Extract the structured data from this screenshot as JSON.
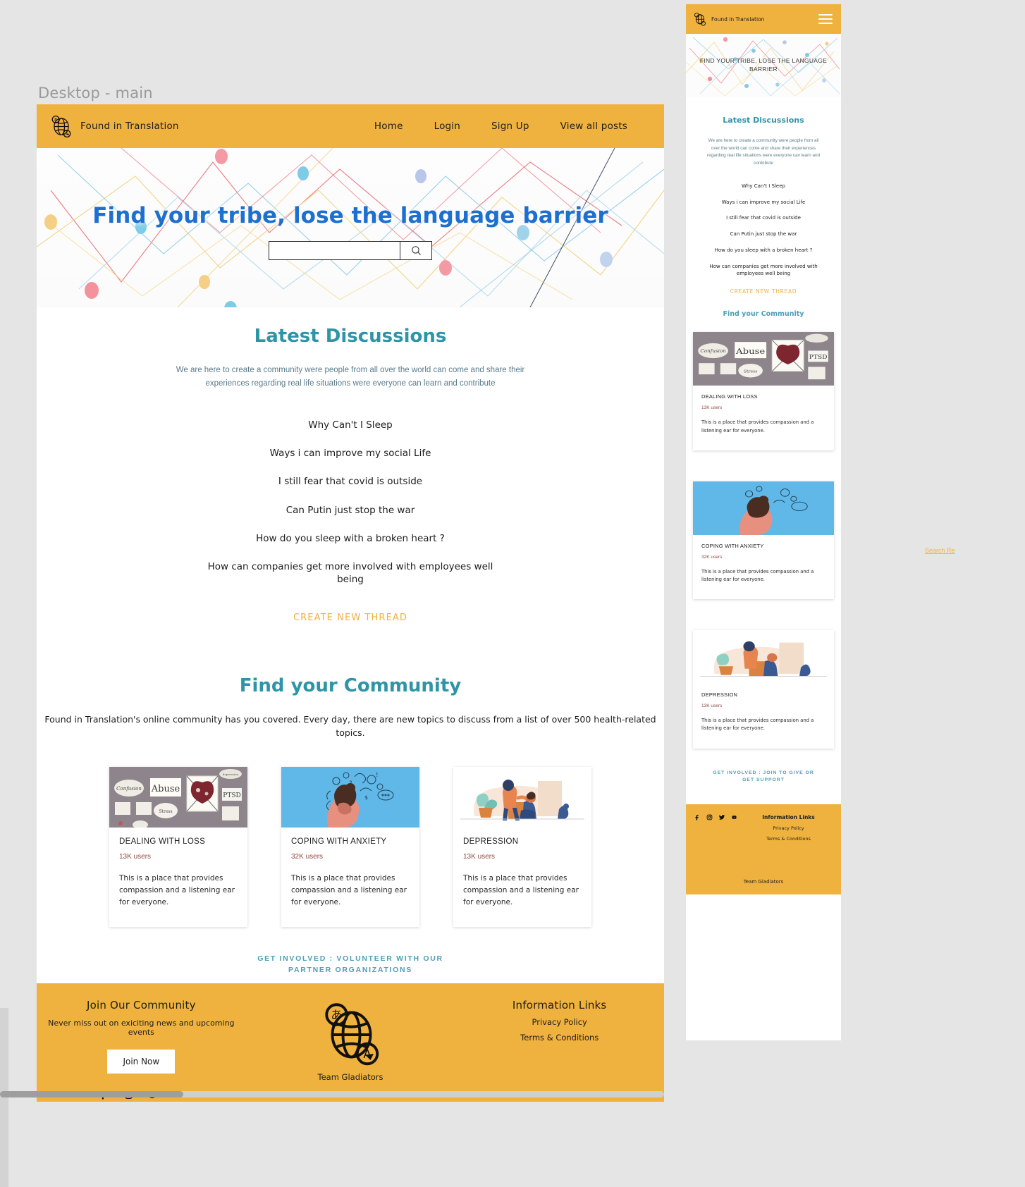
{
  "canvas": {
    "frame_label": "Desktop - main"
  },
  "brand": {
    "name": "Found in Translation",
    "logo_icon": "globe-translate-icon"
  },
  "desktop": {
    "nav": [
      {
        "label": "Home"
      },
      {
        "label": "Login"
      },
      {
        "label": "Sign Up"
      },
      {
        "label": "View all posts"
      }
    ],
    "hero": {
      "title": "Find your tribe, lose the language barrier",
      "search_value": "",
      "search_placeholder": "",
      "search_icon": "magnifier-icon"
    },
    "discussions": {
      "title": "Latest Discussions",
      "subtitle": "We are here to create a community were people from all over the world can come and share their experiences regarding  real life situations were everyone can learn and contribute",
      "threads": [
        "Why Can't I Sleep",
        "Ways i can improve my social Life",
        "I still fear that covid is outside",
        "Can Putin just stop the war",
        "How do you sleep with a broken heart ?",
        "How can companies get more involved with employees well being"
      ],
      "cta": "CREATE  NEW THREAD"
    },
    "community": {
      "title": "Find your Community",
      "subtitle": "Found in Translation's online community has you covered. Every day, there are new topics to discuss from a list of over 500 health-related topics.",
      "cards": [
        {
          "title": "DEALING WITH LOSS",
          "users": "13K users",
          "desc": "This is a place that provides compassion and a listening ear for everyone.",
          "image": "grief-board-photo"
        },
        {
          "title": "COPING WITH  ANXIETY",
          "users": "32K users",
          "desc": "This is a place that provides compassion and a listening ear for everyone.",
          "image": "anxiety-illustration"
        },
        {
          "title": "DEPRESSION",
          "users": "13K users",
          "desc": "This is a place that provides compassion and a listening ear for everyone.",
          "image": "depression-support-illustration"
        }
      ],
      "cta": "GET INVOLVED :  VOLUNTEER WITH OUR PARTNER ORGANIZATIONS"
    },
    "footer": {
      "join_heading": "Join Our Community",
      "join_text": "Never miss out on exiciting news and upcoming events",
      "join_button": "Join Now",
      "socials": [
        "facebook-icon",
        "instagram-icon",
        "twitter-icon",
        "youtube-icon"
      ],
      "team": "Team Gladiators",
      "info_heading": "Information Links",
      "info_links": [
        "Privacy Policy",
        "Terms & Conditions"
      ]
    }
  },
  "mobile": {
    "menu_icon": "hamburger-menu-icon",
    "hero_title": "FIND YOUR TRIBE, LOSE THE LANGUAGE BARRIER",
    "discussions": {
      "title": "Latest Discussions",
      "subtitle": "We are here to create a community were people from all over the world can come and share their experiences regarding  real life situations were everyone can learn and contribute",
      "threads": [
        "Why Can't I Sleep",
        "Ways i can improve my social Life",
        "I still fear that covid is outside",
        "Can Putin just stop the war",
        "How do you sleep with a broken heart ?",
        "How can companies get more involved with employees well being"
      ],
      "cta": "CREATE  NEW THREAD"
    },
    "community": {
      "title": "Find your Community",
      "cards": [
        {
          "title": "DEALING WITH LOSS",
          "users": "13K users",
          "desc": "This is a place that provides compassion and a listening ear for everyone.",
          "image": "grief-board-photo"
        },
        {
          "title": "COPING WITH  ANXIETY",
          "users": "32K users",
          "desc": "This is a place that provides compassion and a listening ear for everyone.",
          "image": "anxiety-illustration"
        },
        {
          "title": "DEPRESSION",
          "users": "13K users",
          "desc": "This is a place that provides compassion and a listening ear for everyone.",
          "image": "depression-support-illustration"
        }
      ],
      "cta": "GET INVOLVED : JOIN TO GIVE OR GET SUPPORT"
    },
    "footer": {
      "socials": [
        "facebook-icon",
        "instagram-icon",
        "twitter-icon",
        "youtube-icon"
      ],
      "info_heading": "Information Links",
      "info_links": [
        "Privacy Policy",
        "Terms & Conditions"
      ],
      "team": "Team Gladiators"
    }
  },
  "edge": {
    "clipped_label": "Search Re"
  },
  "colors": {
    "amber": "#f0b23f",
    "teal": "#2e94a8",
    "hero_blue": "#1d6fd0",
    "users_red": "#8e4a44",
    "canvas_bg": "#e5e5e5"
  }
}
